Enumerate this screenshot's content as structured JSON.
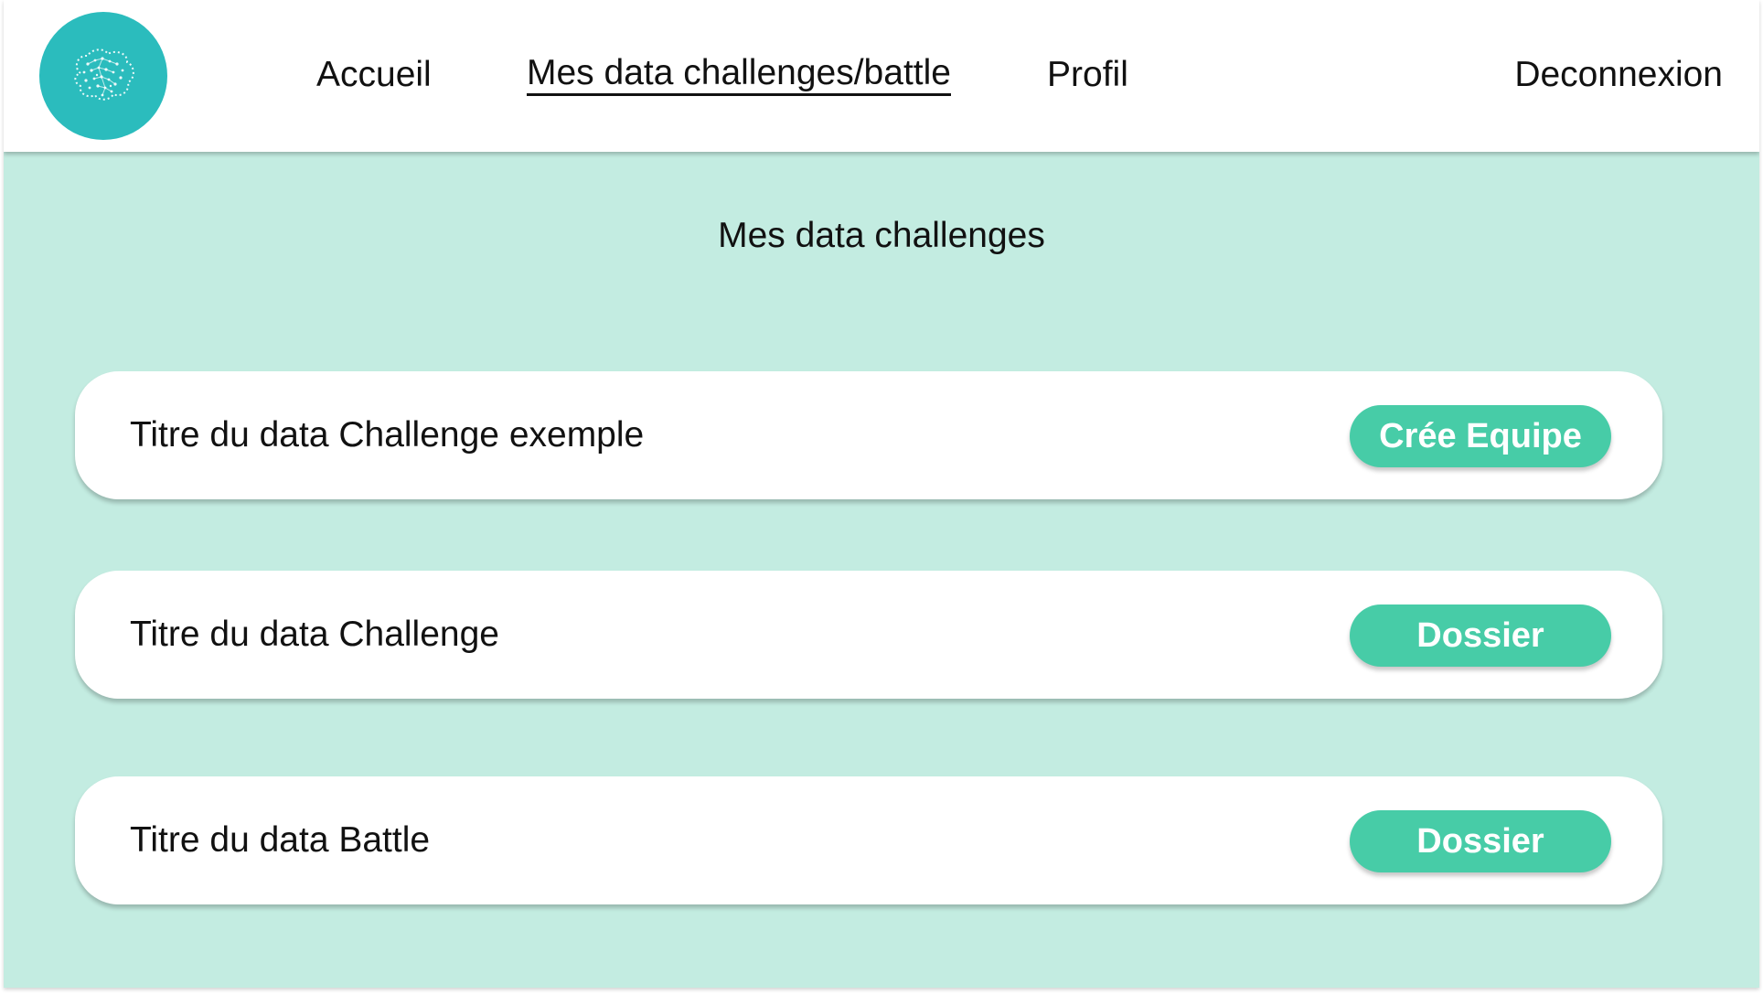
{
  "nav": {
    "logo_icon": "brain-icon",
    "links": [
      {
        "label": "Accueil"
      },
      {
        "label": "Mes data challenges/battle",
        "active": true
      },
      {
        "label": "Profil"
      }
    ],
    "logout_label": "Deconnexion"
  },
  "main": {
    "title": "Mes data challenges",
    "cards": [
      {
        "title": "Titre du data Challenge exemple",
        "button_label": "Crée Equipe"
      },
      {
        "title": "Titre du data Challenge",
        "button_label": "Dossier"
      },
      {
        "title": "Titre du data Battle",
        "button_label": "Dossier"
      }
    ]
  },
  "colors": {
    "background": "#c3ece1",
    "logo": "#2bbcbd",
    "button": "#47cca7",
    "card": "#ffffff"
  }
}
